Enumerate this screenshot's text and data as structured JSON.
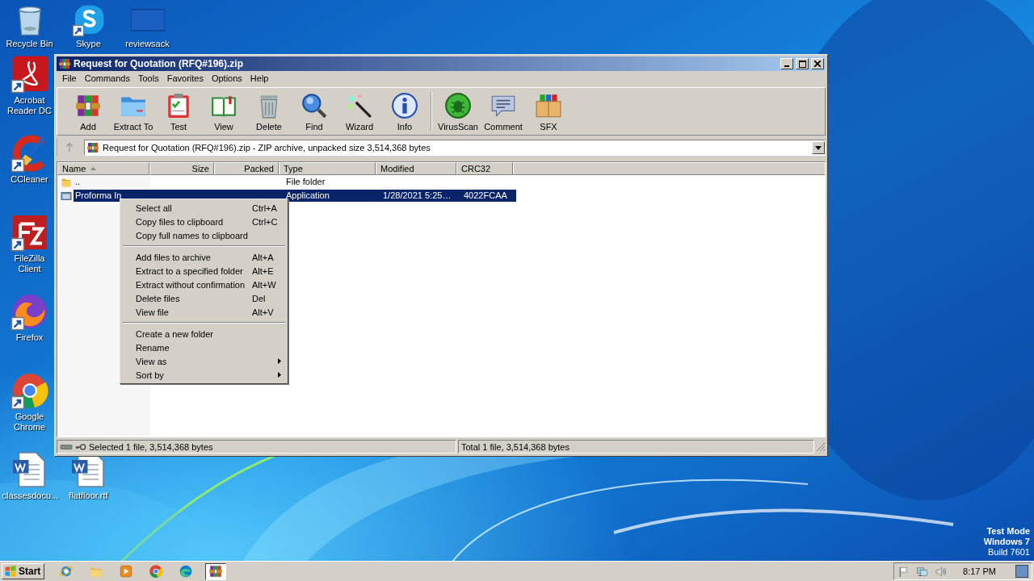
{
  "desktop_icons": [
    {
      "label": "Recycle Bin",
      "kind": "recycle",
      "shortcut": false
    },
    {
      "label": "Skype",
      "kind": "chat",
      "shortcut": true
    },
    {
      "label": "reviewsack",
      "kind": "blank",
      "shortcut": false
    },
    {
      "label": "Acrobat Reader DC",
      "kind": "pdf",
      "shortcut": true
    },
    {
      "label": "CCleaner",
      "kind": "brush",
      "shortcut": true
    },
    {
      "label": "FileZilla Client",
      "kind": "ftp",
      "shortcut": true
    },
    {
      "label": "Firefox",
      "kind": "fox",
      "shortcut": true
    },
    {
      "label": "Google Chrome",
      "kind": "chrome",
      "shortcut": true
    },
    {
      "label": "classesdocu...",
      "kind": "doc",
      "shortcut": false
    },
    {
      "label": "flatfloor.rtf",
      "kind": "doc",
      "shortcut": false
    }
  ],
  "system_notice": [
    "Test Mode",
    "Windows 7",
    "Build 7601"
  ],
  "window": {
    "title": "Request for Quotation (RFQ#196).zip",
    "menu": [
      "File",
      "Commands",
      "Tools",
      "Favorites",
      "Options",
      "Help"
    ],
    "toolbar": [
      [
        {
          "label": "Add",
          "kind": "add"
        },
        {
          "label": "Extract To",
          "kind": "extract"
        },
        {
          "label": "Test",
          "kind": "test"
        },
        {
          "label": "View",
          "kind": "view"
        },
        {
          "label": "Delete",
          "kind": "delete"
        },
        {
          "label": "Find",
          "kind": "find"
        },
        {
          "label": "Wizard",
          "kind": "wizard"
        },
        {
          "label": "Info",
          "kind": "info"
        }
      ],
      [
        {
          "label": "VirusScan",
          "kind": "virus"
        },
        {
          "label": "Comment",
          "kind": "comment"
        },
        {
          "label": "SFX",
          "kind": "sfx"
        }
      ]
    ],
    "address": "Request for Quotation (RFQ#196).zip - ZIP archive, unpacked size 3,514,368 bytes",
    "columns": [
      {
        "label": "Name",
        "sorted": true
      },
      {
        "label": "Size",
        "sorted": false
      },
      {
        "label": "Packed",
        "sorted": false
      },
      {
        "label": "Type",
        "sorted": false
      },
      {
        "label": "Modified",
        "sorted": false
      },
      {
        "label": "CRC32",
        "sorted": false
      }
    ],
    "rows": [
      {
        "kind": "folder",
        "selected": false,
        "name": "..",
        "type": "File folder"
      },
      {
        "kind": "app",
        "selected": true,
        "name": "Proforma In",
        "type": "Application",
        "modified": "1/28/2021 5:25…",
        "crc32": "4022FCAA"
      }
    ],
    "status": [
      "Selected 1 file, 3,514,368 bytes",
      "Total 1 file, 3,514,368 bytes"
    ]
  },
  "context_menu": [
    [
      {
        "label": "Select all",
        "shortcut": "Ctrl+A"
      },
      {
        "label": "Copy files to clipboard",
        "shortcut": "Ctrl+C"
      },
      {
        "label": "Copy full names to clipboard"
      }
    ],
    [
      {
        "label": "Add files to archive",
        "shortcut": "Alt+A"
      },
      {
        "label": "Extract to a specified folder",
        "shortcut": "Alt+E"
      },
      {
        "label": "Extract without confirmation",
        "shortcut": "Alt+W"
      },
      {
        "label": "Delete files",
        "shortcut": "Del"
      },
      {
        "label": "View file",
        "shortcut": "Alt+V"
      }
    ],
    [
      {
        "label": "Create a new folder"
      },
      {
        "label": "Rename"
      },
      {
        "label": "View as",
        "submenu": true
      },
      {
        "label": "Sort by",
        "submenu": true
      }
    ]
  ],
  "taskbar": {
    "start": "Start",
    "apps": [
      {
        "kind": "ie",
        "active": false
      },
      {
        "kind": "explorer",
        "active": false
      },
      {
        "kind": "media",
        "active": false
      },
      {
        "kind": "chrome",
        "active": false
      },
      {
        "kind": "edge",
        "active": false
      },
      {
        "kind": "winrar",
        "active": true
      }
    ],
    "clock": "8:17 PM"
  }
}
